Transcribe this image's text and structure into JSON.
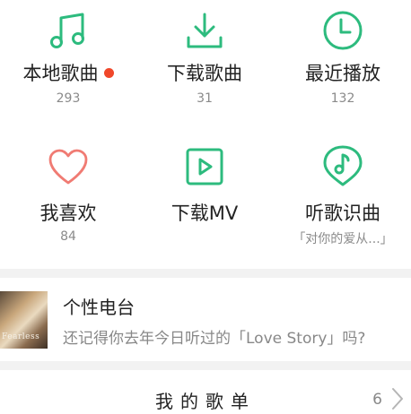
{
  "colors": {
    "accent": "#2dbb7e",
    "heart": "#f07b73",
    "dot": "#f0472a"
  },
  "grid": [
    {
      "icon": "music-note-icon",
      "label": "本地歌曲",
      "count": "293",
      "has_dot": true
    },
    {
      "icon": "download-icon",
      "label": "下载歌曲",
      "count": "31"
    },
    {
      "icon": "clock-icon",
      "label": "最近播放",
      "count": "132"
    },
    {
      "icon": "heart-icon",
      "label": "我喜欢",
      "count": "84"
    },
    {
      "icon": "play-square-icon",
      "label": "下载MV",
      "count": ""
    },
    {
      "icon": "music-pin-icon",
      "label": "听歌识曲",
      "count": "「对你的爱从...」"
    }
  ],
  "radio": {
    "title": "个性电台",
    "subtitle": "还记得你去年今日听过的「Love Story」吗?",
    "thumb_text": "Fearless"
  },
  "playlist": {
    "title": "我的歌单",
    "count": "6"
  }
}
